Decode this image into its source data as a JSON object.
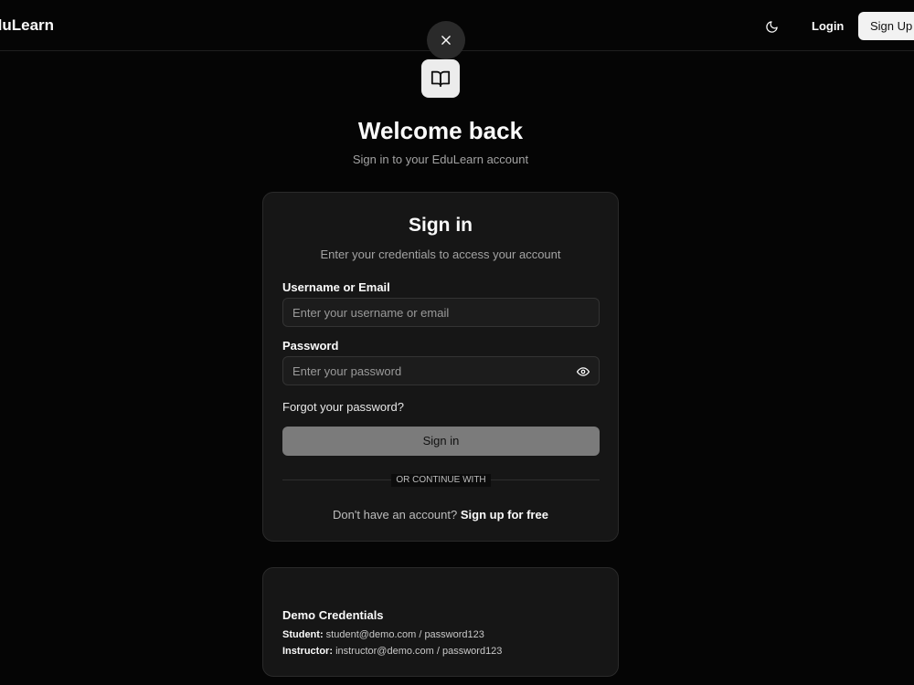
{
  "app": {
    "brand": "duLearn"
  },
  "nav": {
    "login_label": "Login",
    "signup_label": "Sign Up"
  },
  "hero": {
    "title": "Welcome back",
    "subtitle": "Sign in to your EduLearn account"
  },
  "signin_card": {
    "title": "Sign in",
    "subtitle": "Enter your credentials to access your account",
    "username_label": "Username or Email",
    "username_placeholder": "Enter your username or email",
    "username_value": "",
    "password_label": "Password",
    "password_placeholder": "Enter your password",
    "password_value": "",
    "forgot_label": "Forgot your password?",
    "submit_label": "Sign in",
    "divider_label": "OR CONTINUE WITH",
    "signup_prompt": "Don't have an account?",
    "signup_link": "Sign up for free"
  },
  "demo": {
    "title": "Demo Credentials",
    "student_label": "Student:",
    "student_value": "student@demo.com / password123",
    "instructor_label": "Instructor:",
    "instructor_value": "instructor@demo.com / password123"
  },
  "icons": {
    "theme": "moon-icon",
    "close": "close-icon",
    "logo": "book-open-icon",
    "password_toggle": "eye-icon"
  },
  "colors": {
    "background": "#050505",
    "card": "#161616",
    "accent_light": "#f2f2f2",
    "submit_disabled": "#7b7b7b"
  }
}
